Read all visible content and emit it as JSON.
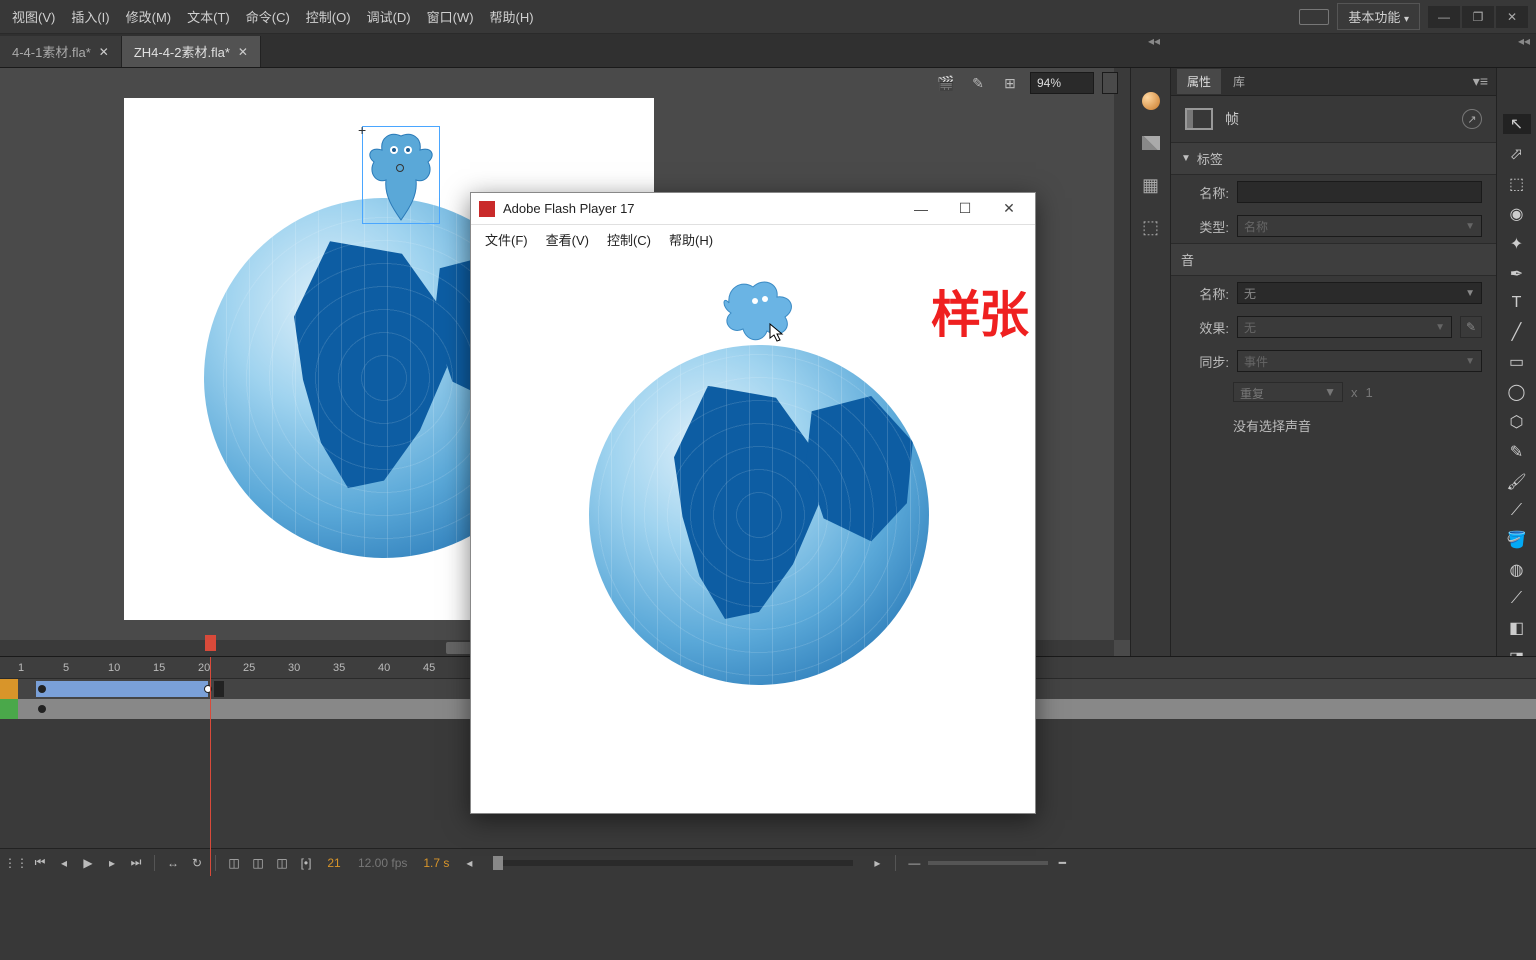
{
  "menubar": {
    "items": [
      "视图(V)",
      "插入(I)",
      "修改(M)",
      "文本(T)",
      "命令(C)",
      "控制(O)",
      "调试(D)",
      "窗口(W)",
      "帮助(H)"
    ],
    "workspace": "基本功能"
  },
  "tabs": [
    {
      "label": "4-4-1素材.fla*"
    },
    {
      "label": "ZH4-4-2素材.fla*"
    }
  ],
  "stage": {
    "zoom": "94%"
  },
  "panels": {
    "tabs": {
      "properties": "属性",
      "library": "库"
    },
    "header_label": "帧",
    "section_label": "标签",
    "name_label": "名称:",
    "name_value": "",
    "type_label": "类型:",
    "type_value": "名称",
    "sound_section": "音",
    "sound_name_label": "名称:",
    "sound_name_value": "无",
    "effect_label": "效果:",
    "effect_value": "无",
    "sync_label": "同步:",
    "sync_value": "事件",
    "repeat_value": "重复",
    "repeat_x": "x",
    "repeat_count": "1",
    "no_sound": "没有选择声音"
  },
  "timeline": {
    "marks": [
      "1",
      "5",
      "10",
      "15",
      "20",
      "25",
      "30",
      "35",
      "40",
      "45"
    ],
    "current_frame": "21",
    "fps": "12.00 fps",
    "time": "1.7 s"
  },
  "flash_player": {
    "title": "Adobe Flash Player 17",
    "menu": [
      "文件(F)",
      "查看(V)",
      "控制(C)",
      "帮助(H)"
    ],
    "watermark": "样张"
  }
}
